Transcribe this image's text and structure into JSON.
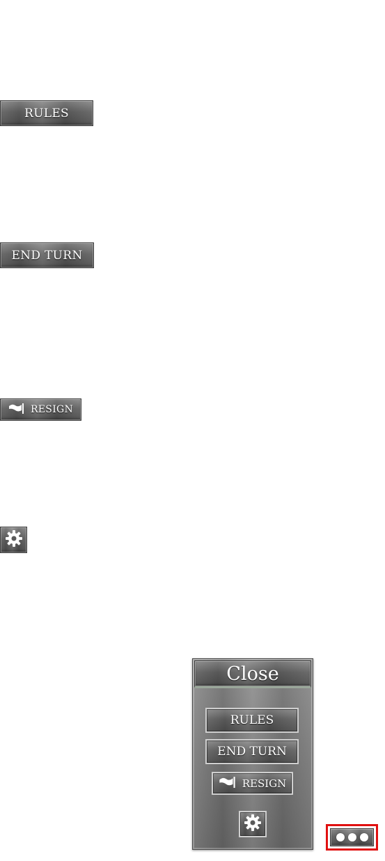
{
  "buttons": {
    "rules_label": "RULES",
    "end_turn_label": "END TURN",
    "resign_label": "RESIGN",
    "settings_icon": "gear-icon",
    "resign_icon": "flag-icon"
  },
  "menu": {
    "close_label": "Close",
    "rules_label": "RULES",
    "end_turn_label": "END TURN",
    "resign_label": "RESIGN",
    "settings_icon": "gear-icon"
  },
  "more_button": {
    "icon": "ellipsis-icon",
    "highlight_color": "#e01010"
  }
}
